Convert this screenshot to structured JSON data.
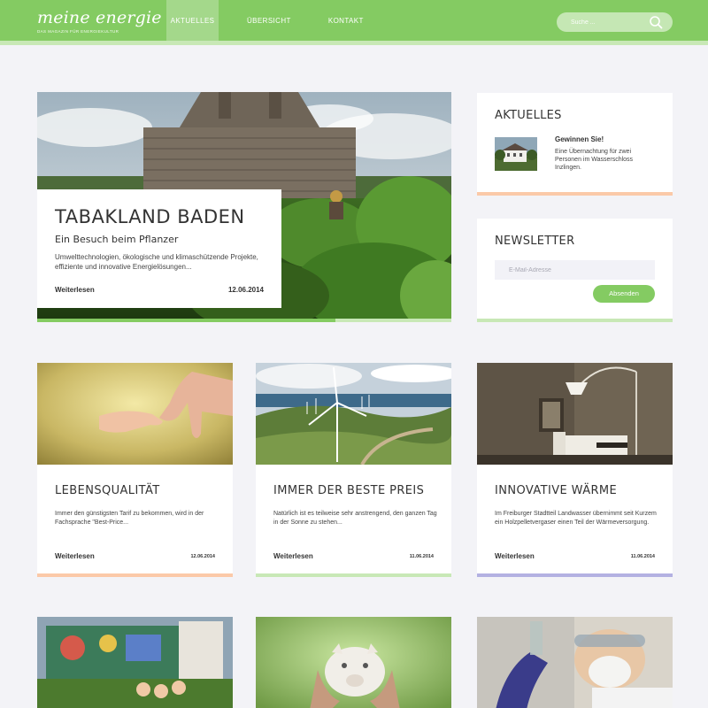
{
  "header": {
    "logo_title": "meine energie",
    "logo_subtitle": "DAS MAGAZIN FÜR ENERGIEKULTUR",
    "nav": [
      {
        "label": "AKTUELLES",
        "active": true
      },
      {
        "label": "ÜBERSICHT",
        "active": false
      },
      {
        "label": "KONTAKT",
        "active": false
      }
    ],
    "search_placeholder": "Suche ...",
    "search_icon": "magnifier-icon"
  },
  "hero": {
    "title": "TABAKLAND BADEN",
    "subtitle": "Ein Besuch beim Pflanzer",
    "text": "Umwelttechnologien, ökologische und klimaschützende Projekte, effiziente und innovative Energielösungen...",
    "read_more": "Weiterlesen",
    "date": "12.06.2014",
    "progress": 0.72
  },
  "aktuelles": {
    "title": "AKTUELLES",
    "item_title": "Gewinnen Sie!",
    "item_text": "Eine Übernachtung für zwei Personen im Wasserschloss Inzlingen."
  },
  "newsletter": {
    "title": "NEWSLETTER",
    "email_placeholder": "E-Mail-Adresse",
    "submit_label": "Absenden"
  },
  "cards": [
    {
      "title": "LEBENSQUALITÄT",
      "text": "Immer den günstigsten Tarif zu bekommen, wird in der Fachsprache \"Best-Price...",
      "read_more": "Weiterlesen",
      "date": "12.06.2014",
      "accent": "#fbc9a8"
    },
    {
      "title": "IMMER DER BESTE PREIS",
      "text": "Natürlich ist es teilweise sehr anstrengend, den ganzen Tag in der Sonne zu stehen...",
      "read_more": "Weiterlesen",
      "date": "11.06.2014",
      "accent": "#c8e8b6"
    },
    {
      "title": "INNOVATIVE WÄRME",
      "text": "Im Freiburger Stadtteil Landwasser übernimmt seit Kurzem ein Holzpelletvergaser einen Teil der Wärmeversorgung.",
      "read_more": "Weiterlesen",
      "date": "11.06.2014",
      "accent": "#b3b1e2"
    }
  ],
  "colors": {
    "brand_green": "#84cb62",
    "light_green": "#c8e8b6",
    "background": "#f3f3f7"
  }
}
